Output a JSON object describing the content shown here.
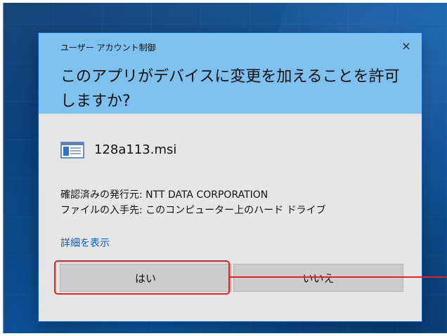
{
  "dialog": {
    "title": "ユーザー アカウント制御",
    "question": "このアプリがデバイスに変更を加えることを許可しますか?",
    "file_name": "128a113.msi",
    "publisher_line": "確認済みの発行元: NTT DATA CORPORATION",
    "origin_line": "ファイルの入手先: このコンピューター上のハード ドライブ",
    "show_details_link": "詳細を表示",
    "yes_button_label": "はい",
    "no_button_label": "いいえ",
    "close_icon": "×"
  },
  "icons": {
    "close": "close-icon",
    "file": "msi-file-icon"
  },
  "colors": {
    "header_bg": "#7ec0ee",
    "dialog_bg": "#e6e6e6",
    "button_bg": "#cccccc",
    "link": "#0b5cc0",
    "highlight": "#ea1f1f"
  }
}
